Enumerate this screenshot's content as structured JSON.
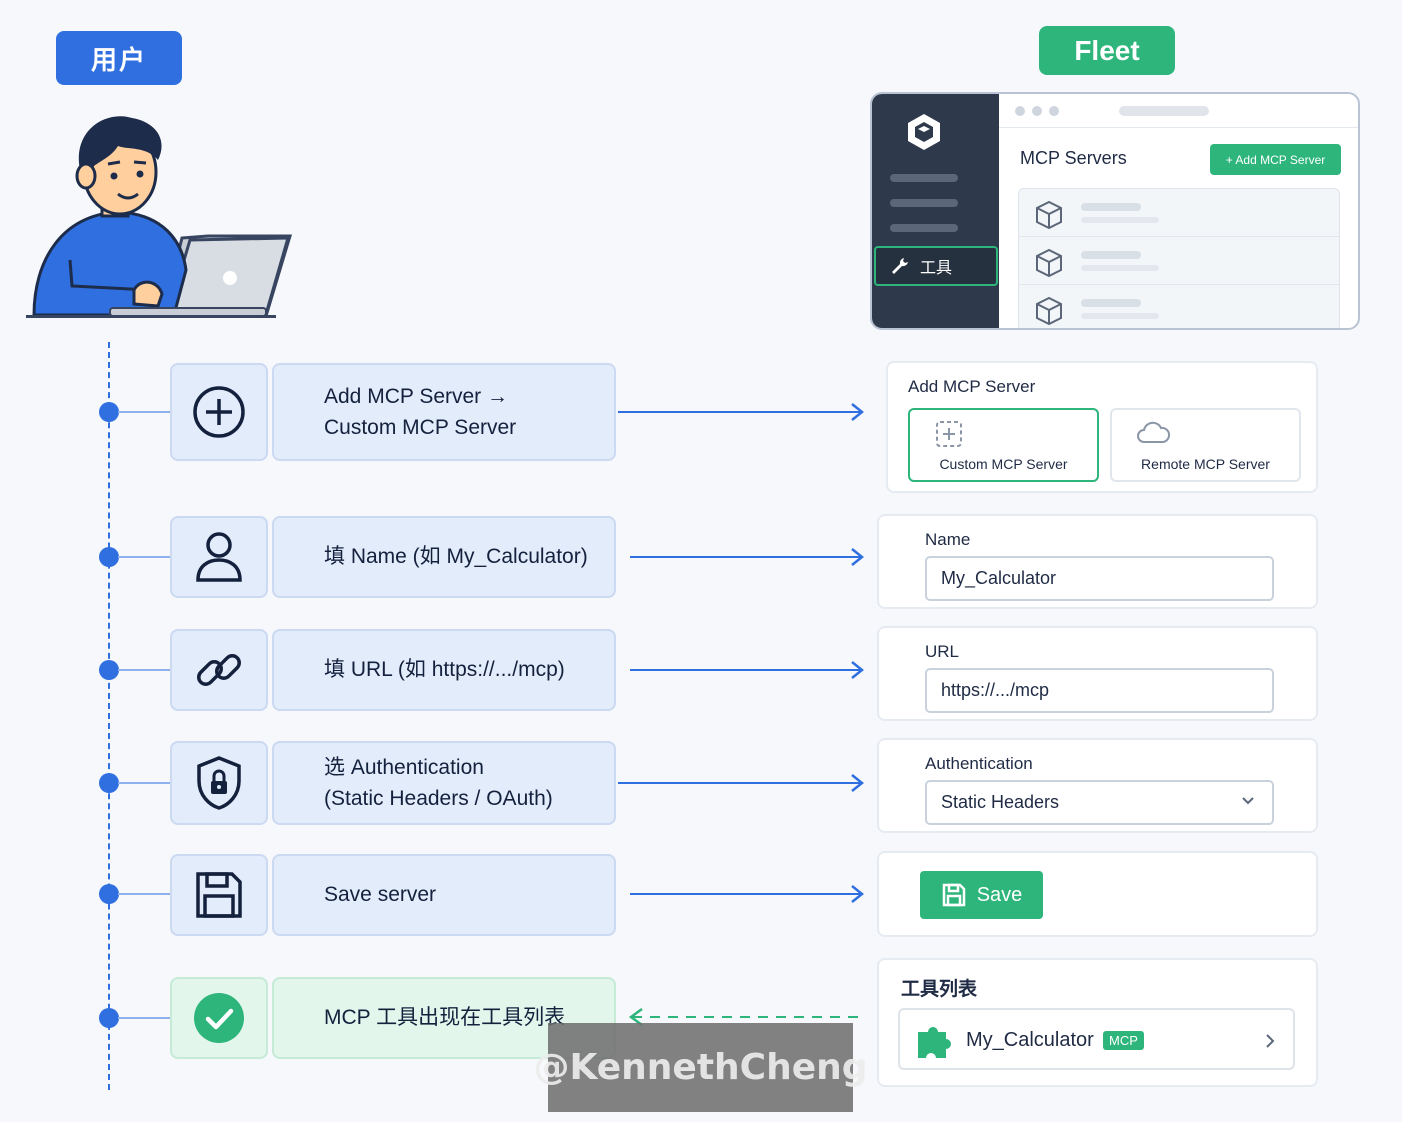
{
  "headers": {
    "user": "用户",
    "fleet": "Fleet"
  },
  "app": {
    "sidebar_tool_label": "工具",
    "title": "MCP Servers",
    "add_button": "+ Add MCP Server"
  },
  "steps": [
    {
      "line1": "Add MCP Server →",
      "line2": "Custom MCP Server",
      "icon": "plus-circle-icon"
    },
    {
      "line1": "填 Name (如 My_Calculator)",
      "line2": "",
      "icon": "user-icon"
    },
    {
      "line1": "填 URL (如 https://.../mcp)",
      "line2": "",
      "icon": "link-icon"
    },
    {
      "line1": "选 Authentication",
      "line2": "(Static Headers / OAuth)",
      "icon": "shield-lock-icon"
    },
    {
      "line1": "Save server",
      "line2": "",
      "icon": "floppy-disk-icon"
    },
    {
      "line1": "MCP 工具出现在工具列表",
      "line2": "",
      "icon": "check-circle-icon"
    }
  ],
  "add_card": {
    "title": "Add MCP Server",
    "option_custom": "Custom MCP Server",
    "option_remote": "Remote MCP Server"
  },
  "name_card": {
    "label": "Name",
    "value": "My_Calculator"
  },
  "url_card": {
    "label": "URL",
    "value": "https://.../mcp"
  },
  "auth_card": {
    "label": "Authentication",
    "value": "Static Headers"
  },
  "save_card": {
    "button": "Save"
  },
  "tools_card": {
    "title": "工具列表",
    "item": "My_Calculator",
    "tag": "MCP"
  },
  "watermark": "@KennethCheng",
  "colors": {
    "blue": "#2f6fe0",
    "green": "#2db57b",
    "dark": "#2e3a4b"
  }
}
